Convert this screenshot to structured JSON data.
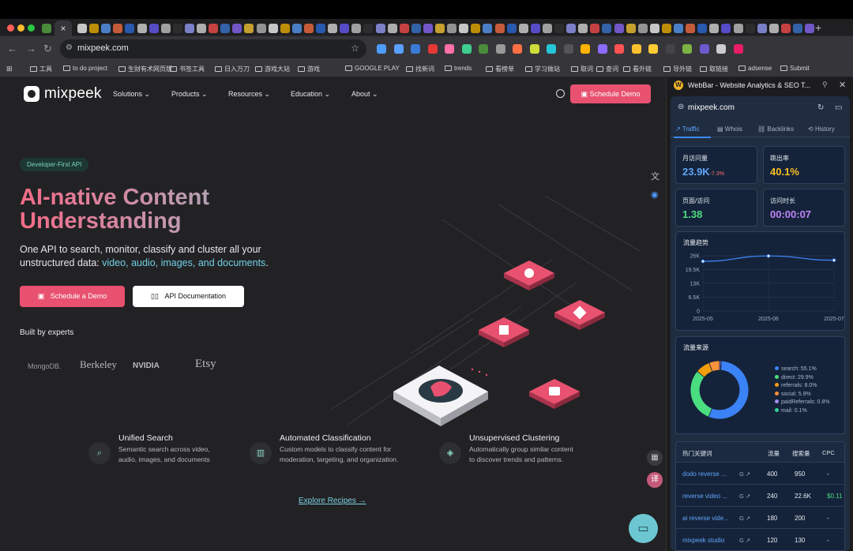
{
  "browser": {
    "tab_close_glyph": "×",
    "url": "mixpeek.com",
    "bookmarks": [
      "工具",
      "to do project",
      "生财有术网页版",
      "书签工具",
      "日入万刀",
      "游戏大站",
      "游戏",
      "GOOGLE PLAY",
      "找新词",
      "trends",
      "看榜单",
      "学习做站",
      "取词",
      "查词",
      "看外链",
      "导外链",
      "取链接",
      "adsense",
      "Submit"
    ]
  },
  "site": {
    "logo": "mixpeek",
    "nav": [
      "Solutions",
      "Products",
      "Resources",
      "Education",
      "About"
    ],
    "cta_top": "Schedule Demo",
    "badge": "Developer-First API",
    "headline": "AI-native Content Understanding",
    "sub_a": "One API to search, monitor, classify and cluster all your unstructured data: ",
    "sub_hl": "video, audio, images, and documents",
    "sub_b": ".",
    "btn_demo": "Schedule a Demo",
    "btn_api": "API Documentation",
    "built_by": "Built by experts",
    "partners": [
      "MongoDB.",
      "Berkeley",
      "NVIDIA",
      "Etsy"
    ],
    "features": [
      {
        "title": "Unified Search",
        "desc": "Semantic search across video, audio, images, and documents"
      },
      {
        "title": "Automated Classification",
        "desc": "Custom models to classify content for moderation, targeting, and organization."
      },
      {
        "title": "Unsupervised Clustering",
        "desc": "Automatically group similar content to discover trends and patterns."
      }
    ],
    "explore": "Explore Recipes →"
  },
  "webbar": {
    "title": "WebBar - Website Analytics & SEO T...",
    "domain": "mixpeek.com",
    "tabs": [
      "Traffic",
      "Whois",
      "Backlinks",
      "History"
    ],
    "stats": [
      {
        "label": "月访问量",
        "value": "23.9K",
        "change": "-7.3%",
        "color": "#60a5fa"
      },
      {
        "label": "跳出率",
        "value": "40.1%",
        "change": "",
        "color": "#fbbf24"
      },
      {
        "label": "页面/访问",
        "value": "1.38",
        "change": "",
        "color": "#4ade80"
      },
      {
        "label": "访问时长",
        "value": "00:00:07",
        "change": "",
        "color": "#c084fc"
      }
    ],
    "traffic_title": "流量趋势",
    "sources_title": "流量来源",
    "keywords": {
      "headers": [
        "热门关键词",
        "流量",
        "搜索量",
        "CPC"
      ],
      "rows": [
        {
          "kw": "dodo reverse ...",
          "traffic": "400",
          "volume": "950",
          "cpc": "-"
        },
        {
          "kw": "reverse video ...",
          "traffic": "240",
          "volume": "22.6K",
          "cpc": "$0.11"
        },
        {
          "kw": "ai reverse vide...",
          "traffic": "180",
          "volume": "200",
          "cpc": "-"
        },
        {
          "kw": "mixpeek studio",
          "traffic": "120",
          "volume": "130",
          "cpc": "-"
        }
      ]
    }
  },
  "chart_data": [
    {
      "type": "line",
      "title": "流量趋势",
      "x": [
        "2025-05",
        "2025-06",
        "2025-07"
      ],
      "series": [
        {
          "values": [
            23400,
            25900,
            23900
          ]
        }
      ],
      "yticks": [
        "26K",
        "19.5K",
        "13K",
        "6.5K",
        "0"
      ],
      "ylim": [
        0,
        26000
      ],
      "grid": true,
      "color": "#3b82f6"
    },
    {
      "type": "pie",
      "title": "流量来源",
      "labels": [
        "search",
        "direct",
        "referrals",
        "social",
        "paidReferrals",
        "mail"
      ],
      "values": [
        55.1,
        29.9,
        8.0,
        5.9,
        0.8,
        0.1
      ],
      "colors": [
        "#3b82f6",
        "#4ade80",
        "#f59e0b",
        "#fb923c",
        "#a78bfa",
        "#34d399"
      ],
      "legend": "right"
    }
  ]
}
